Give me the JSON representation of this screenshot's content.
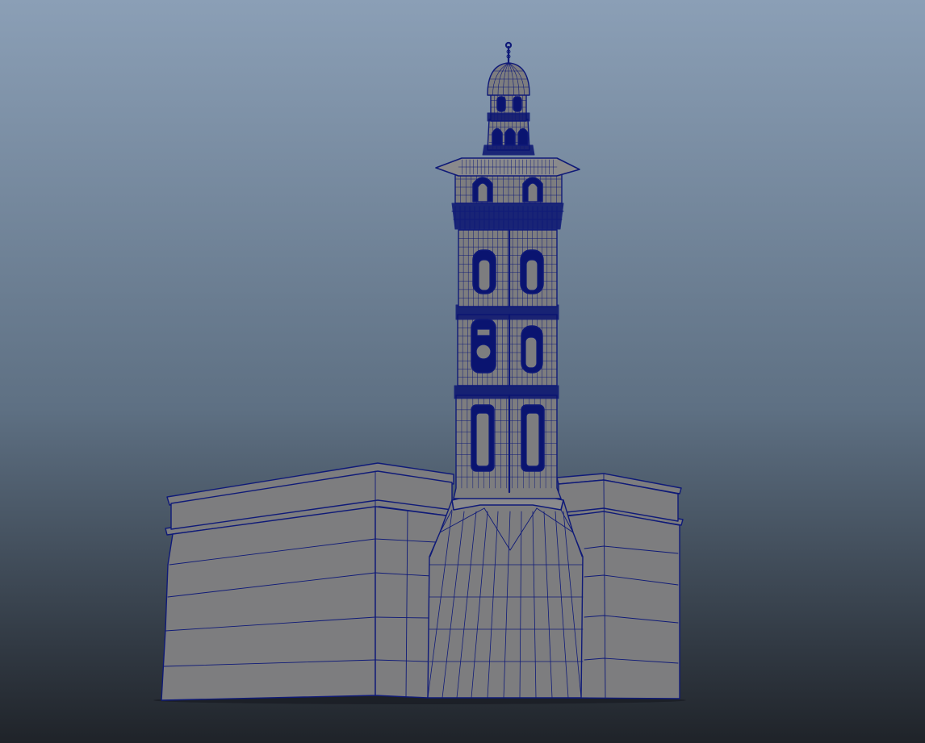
{
  "viewport": {
    "background_top": "#8b9fb6",
    "background_mid": "#5e7083",
    "background_bottom": "#1f2329",
    "mesh_fill": "#7d7d7f",
    "mesh_fill_light": "#8a8a8c",
    "wireframe_color": "#0f1a78",
    "wireframe_dense": "#0a1470"
  },
  "scene": {
    "model": "minaret-wireframe",
    "display_mode": "wireframe-on-shaded"
  }
}
